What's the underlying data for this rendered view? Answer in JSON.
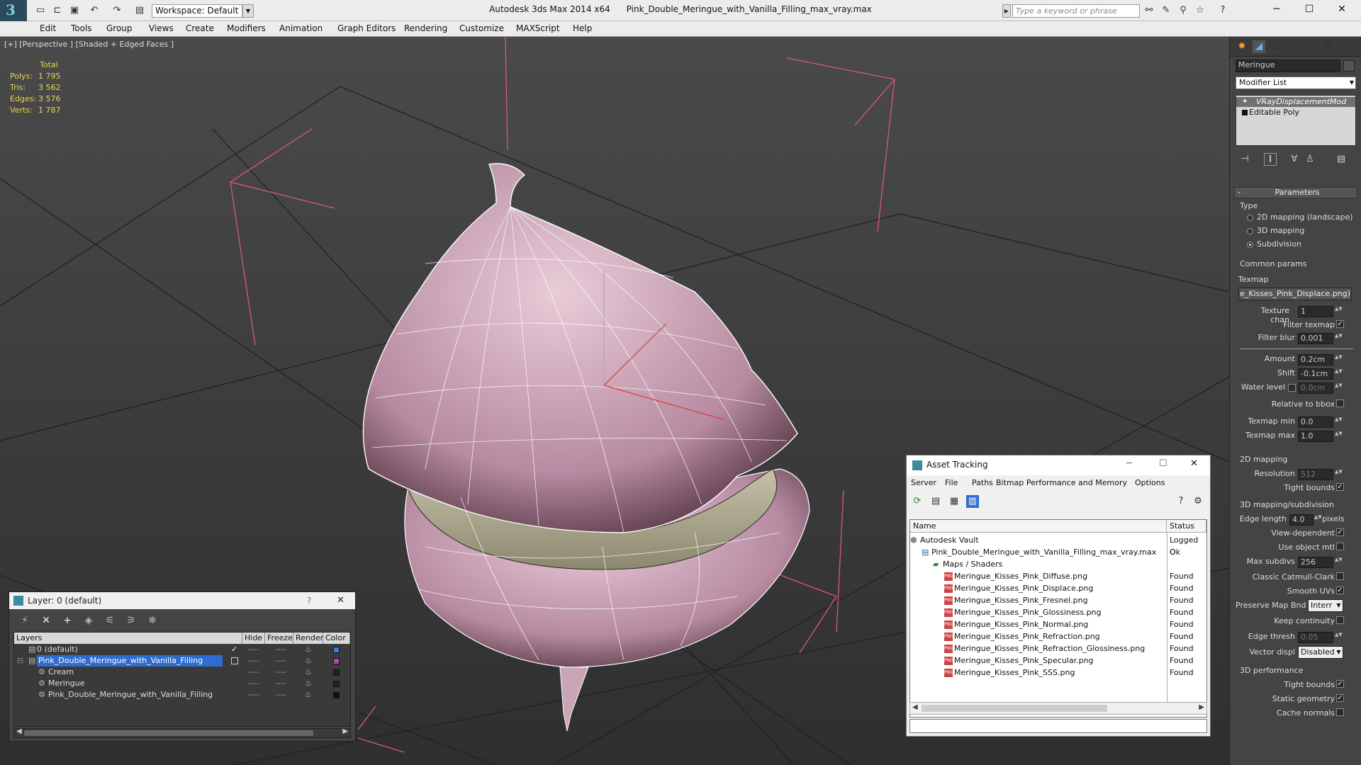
{
  "titlebar": {
    "workspace": "Workspace: Default",
    "app_title": "Autodesk 3ds Max  2014 x64",
    "file_title": "Pink_Double_Meringue_with_Vanilla_Filling_max_vray.max",
    "search_placeholder": "Type a keyword or phrase"
  },
  "menu": [
    "Edit",
    "Tools",
    "Group",
    "Views",
    "Create",
    "Modifiers",
    "Animation",
    "Graph Editors",
    "Rendering",
    "Customize",
    "MAXScript",
    "Help"
  ],
  "viewport": {
    "label": "[+] [Perspective ] [Shaded + Edged Faces ]",
    "stats_header": "Total",
    "stats": [
      {
        "label": "Polys:",
        "value": "1 795"
      },
      {
        "label": "Tris:",
        "value": "3 562"
      },
      {
        "label": "Edges:",
        "value": "3 576"
      },
      {
        "label": "Verts:",
        "value": "1 787"
      }
    ]
  },
  "command_panel": {
    "object_name": "Meringue",
    "modifier_list": "Modifier List",
    "stack": [
      "VRayDisplacementMod",
      "Editable Poly"
    ],
    "parameters": "Parameters",
    "type_label": "Type",
    "type_options": [
      "2D mapping (landscape)",
      "3D mapping",
      "Subdivision"
    ],
    "common_params": "Common params",
    "texmap_label": "Texmap",
    "texmap_value": "e_Kisses_Pink_Displace.png)",
    "texture_chan": {
      "label": "Texture chan",
      "value": "1"
    },
    "filter_texmap": "Filter texmap",
    "filter_blur": {
      "label": "Filter blur",
      "value": "0.001"
    },
    "amount": {
      "label": "Amount",
      "value": "0.2cm"
    },
    "shift": {
      "label": "Shift",
      "value": "-0.1cm"
    },
    "water_level": {
      "label": "Water level",
      "value": "0.0cm"
    },
    "relative_bbox": "Relative to bbox",
    "texmap_min": {
      "label": "Texmap min",
      "value": "0.0"
    },
    "texmap_max": {
      "label": "Texmap max",
      "value": "1.0"
    },
    "mapping2d": "2D mapping",
    "resolution": {
      "label": "Resolution",
      "value": "512"
    },
    "tight_bounds": "Tight bounds",
    "mapping3d": "3D mapping/subdivision",
    "edge_length": {
      "label": "Edge length",
      "value": "4.0",
      "unit": "pixels"
    },
    "view_dependent": "View-dependent",
    "use_object_mtl": "Use object mtl",
    "max_subdivs": {
      "label": "Max subdivs",
      "value": "256"
    },
    "classic_catmull": "Classic Catmull-Clark",
    "smooth_uvs": "Smooth UVs",
    "preserve_map": {
      "label": "Preserve Map Bnd",
      "value": "Interr"
    },
    "keep_continuity": "Keep continuity",
    "edge_thresh": {
      "label": "Edge thresh",
      "value": "0.05"
    },
    "vector_displ": {
      "label": "Vector displ",
      "value": "Disabled"
    },
    "perf": "3D performance",
    "tight_bounds2": "Tight bounds",
    "static_geometry": "Static geometry",
    "cache_normals": "Cache normals"
  },
  "layer_window": {
    "title": "Layer: 0 (default)",
    "help": "?",
    "columns": [
      "Layers",
      "Hide",
      "Freeze",
      "Render",
      "Color"
    ],
    "rows": [
      {
        "name": "0 (default)",
        "color": "#3d7bd6"
      },
      {
        "name": "Pink_Double_Meringue_with_Vanilla_Filling",
        "color": "#b04bb4"
      },
      {
        "name": "Cream",
        "color": "#222222"
      },
      {
        "name": "Meringue",
        "color": "#222222"
      },
      {
        "name": "Pink_Double_Meringue_with_Vanilla_Filling",
        "color": "#111111"
      }
    ]
  },
  "asset_window": {
    "title": "Asset Tracking",
    "menu": [
      "Server",
      "File",
      "Paths",
      "Bitmap Performance and Memory",
      "Options"
    ],
    "columns": [
      "Name",
      "Status"
    ],
    "rows": [
      {
        "name": "Autodesk Vault",
        "status": "Logged O"
      },
      {
        "name": "Pink_Double_Meringue_with_Vanilla_Filling_max_vray.max",
        "status": "Ok"
      },
      {
        "name": "Maps / Shaders",
        "status": ""
      },
      {
        "name": "Meringue_Kisses_Pink_Diffuse.png",
        "status": "Found"
      },
      {
        "name": "Meringue_Kisses_Pink_Displace.png",
        "status": "Found"
      },
      {
        "name": "Meringue_Kisses_Pink_Fresnel.png",
        "status": "Found"
      },
      {
        "name": "Meringue_Kisses_Pink_Glossiness.png",
        "status": "Found"
      },
      {
        "name": "Meringue_Kisses_Pink_Normal.png",
        "status": "Found"
      },
      {
        "name": "Meringue_Kisses_Pink_Refraction.png",
        "status": "Found"
      },
      {
        "name": "Meringue_Kisses_Pink_Refraction_Glossiness.png",
        "status": "Found"
      },
      {
        "name": "Meringue_Kisses_Pink_Specular.png",
        "status": "Found"
      },
      {
        "name": "Meringue_Kisses_Pink_SSS.png",
        "status": "Found"
      }
    ]
  }
}
